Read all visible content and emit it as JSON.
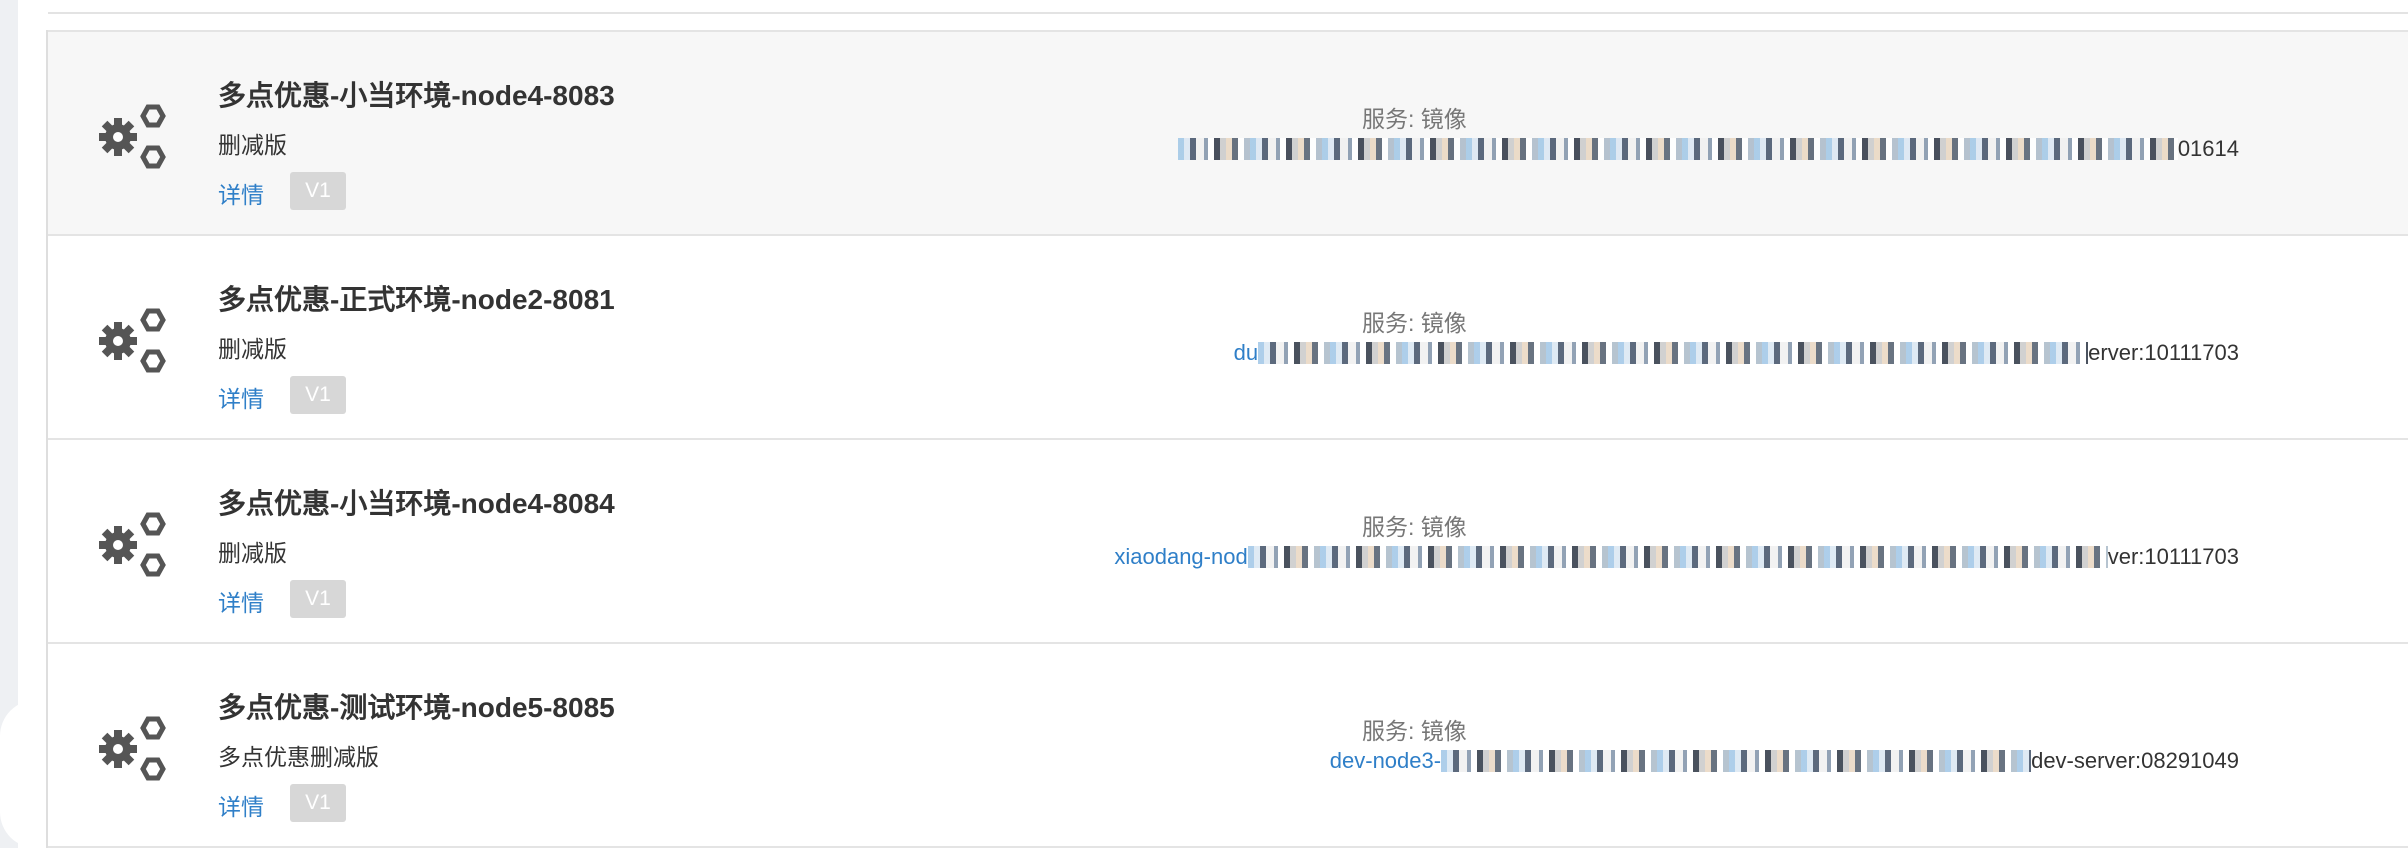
{
  "rows": [
    {
      "title": "多点优惠-小当环境-node4-8083",
      "description": "删减版",
      "detail_link": "详情",
      "version_badge": "V1",
      "service_label": "服务: 镜像",
      "image_prefix": "",
      "image_suffix": "01614",
      "active": true
    },
    {
      "title": "多点优惠-正式环境-node2-8081",
      "description": "删减版",
      "detail_link": "详情",
      "version_badge": "V1",
      "service_label": "服务: 镜像",
      "image_prefix": "du",
      "image_suffix": "erver:10111703",
      "active": false
    },
    {
      "title": "多点优惠-小当环境-node4-8084",
      "description": "删减版",
      "detail_link": "详情",
      "version_badge": "V1",
      "service_label": "服务: 镜像",
      "image_prefix": "xiaodang-nod",
      "image_suffix": "ver:10111703",
      "active": false
    },
    {
      "title": "多点优惠-测试环境-node5-8085",
      "description": "多点优惠删减版",
      "detail_link": "详情",
      "version_badge": "V1",
      "service_label": "服务: 镜像",
      "image_prefix": "dev-node3-",
      "image_suffix": "dev-server:08291049",
      "active": false
    }
  ],
  "icons": {
    "row_icon": "gears-icon"
  },
  "colors": {
    "link": "#2f7fc8",
    "badge_bg": "#d7d7d7",
    "active_row_bg": "#f7f7f7"
  }
}
